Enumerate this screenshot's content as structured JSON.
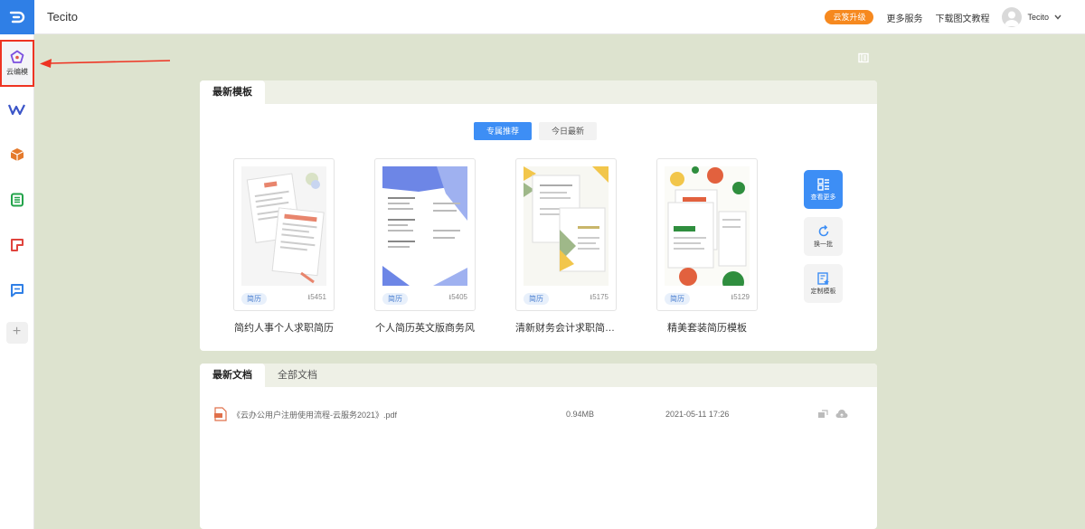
{
  "app": {
    "title": "Tecito"
  },
  "sidebar": {
    "items": [
      {
        "name": "cloud-edit",
        "label": "云编模",
        "icon": "pentagon-icon",
        "color": "#7b4fe0"
      },
      {
        "name": "writer",
        "label": "",
        "icon": "w-doc-icon",
        "color": "#3b55c8"
      },
      {
        "name": "box",
        "label": "",
        "icon": "box-icon",
        "color": "#e57a2c"
      },
      {
        "name": "sheet",
        "label": "",
        "icon": "sheet-icon",
        "color": "#22a34a"
      },
      {
        "name": "present",
        "label": "",
        "icon": "slides-icon",
        "color": "#e0443d"
      },
      {
        "name": "chat",
        "label": "",
        "icon": "chat-icon",
        "color": "#2f7fe6"
      }
    ],
    "add_label": "+"
  },
  "topbar": {
    "upgrade": "云笈升级",
    "more_services": "更多服务",
    "download_tutorial": "下载图文教程",
    "user_name": "Tecito"
  },
  "templates": {
    "tab_latest": "最新模板",
    "seg_recommended": "专属推荐",
    "seg_today": "今日最新",
    "items": [
      {
        "name": "简约人事个人求职简历",
        "tag": "简历",
        "downloads": "5451"
      },
      {
        "name": "个人简历英文版商务风",
        "tag": "简历",
        "downloads": "5405"
      },
      {
        "name": "清新财务会计求职简历...",
        "tag": "简历",
        "downloads": "5175"
      },
      {
        "name": "精美套装简历模板",
        "tag": "简历",
        "downloads": "5129"
      }
    ],
    "actions": {
      "view_more": "查看更多",
      "refresh": "换一批",
      "custom": "定制模板"
    }
  },
  "documents": {
    "tab_latest": "最新文档",
    "tab_all": "全部文档",
    "rows": [
      {
        "name": "《云办公用户注册使用流程-云服务2021》.pdf",
        "size": "0.94MB",
        "date": "2021-05-11 17:26"
      }
    ]
  },
  "colors": {
    "accent": "#3d8ef5",
    "upgrade": "#f6891f",
    "background": "#dde3cf"
  }
}
